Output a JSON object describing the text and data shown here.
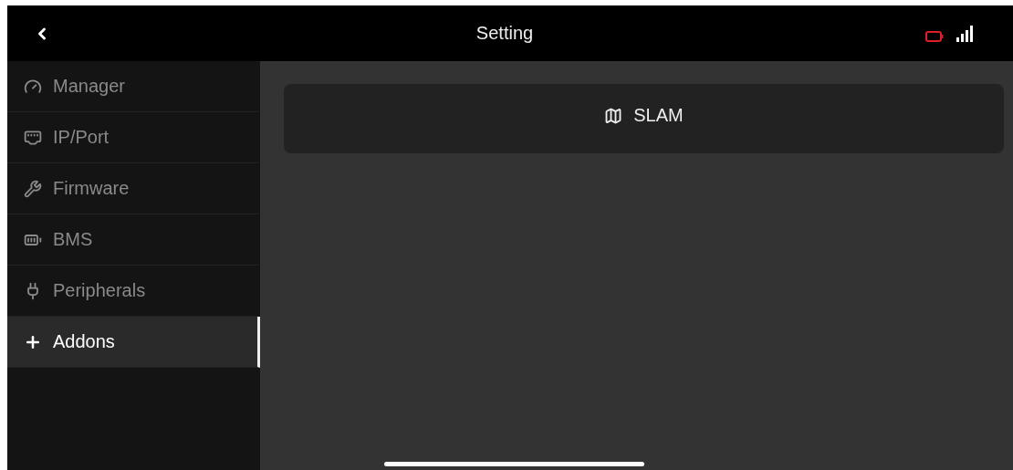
{
  "header": {
    "title": "Setting"
  },
  "sidebar": {
    "items": [
      {
        "kind": "gauge",
        "label": "Manager",
        "selected": false
      },
      {
        "kind": "ethernet",
        "label": "IP/Port",
        "selected": false
      },
      {
        "kind": "wrench",
        "label": "Firmware",
        "selected": false
      },
      {
        "kind": "battery",
        "label": "BMS",
        "selected": false
      },
      {
        "kind": "plug",
        "label": "Peripherals",
        "selected": false
      },
      {
        "kind": "plus",
        "label": "Addons",
        "selected": true
      }
    ]
  },
  "content": {
    "buttons": [
      {
        "kind": "map",
        "label": "SLAM"
      }
    ]
  }
}
